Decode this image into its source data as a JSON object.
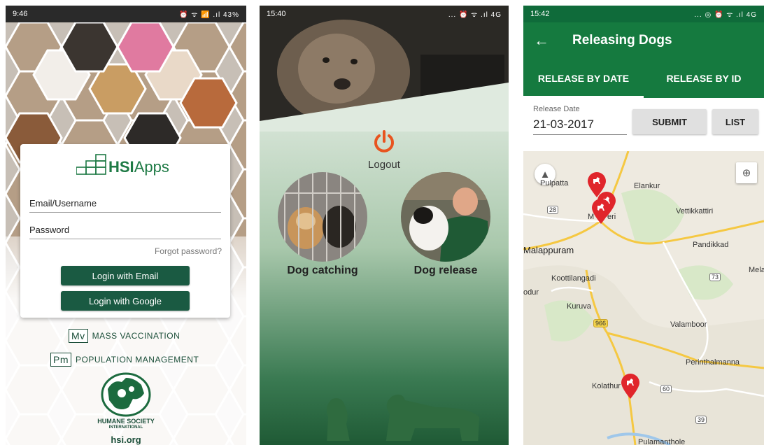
{
  "screen1": {
    "status": {
      "time": "9:46",
      "icons": "⏰ ᯤ 📶 .ıl 43%",
      "battery": "▮"
    },
    "brand": {
      "hsi": "HSI",
      "apps": "Apps"
    },
    "form": {
      "email_label": "Email/Username",
      "password_label": "Password",
      "forgot": "Forgot password?",
      "login_email": "Login with Email",
      "login_google": "Login with Google"
    },
    "programs": [
      {
        "abbr": "Mv",
        "name": "MASS VACCINATION"
      },
      {
        "abbr": "Pm",
        "name": "POPULATION MANAGEMENT"
      }
    ],
    "org": {
      "line1": "HUMANE SOCIETY",
      "line2": "INTERNATIONAL",
      "link": "hsi.org"
    }
  },
  "screen2": {
    "status": {
      "time": "15:40",
      "icons": "... ⏰ ᯤ .ıl 4G"
    },
    "logout": "Logout",
    "menu": [
      {
        "label": "Dog catching"
      },
      {
        "label": "Dog release"
      }
    ]
  },
  "screen3": {
    "status": {
      "time": "15:42",
      "icons": "... ◎ ⏰ ᯤ .ıl 4G"
    },
    "title": "Releasing Dogs",
    "tabs": [
      {
        "label": "RELEASE BY DATE",
        "active": true
      },
      {
        "label": "RELEASE BY ID",
        "active": false
      }
    ],
    "date_label": "Release Date",
    "date_value": "21-03-2017",
    "submit": "SUBMIT",
    "list": "LIST",
    "map": {
      "places": [
        "Pulpatta",
        "Elankur",
        "Vettikkattiri",
        "Malappuram",
        "Pandikkad",
        "Mela",
        "Koottilangadi",
        "odur",
        "Kuruva",
        "Valamboor",
        "Perinthalmanna",
        "Kolathur",
        "Pulamanthole",
        "M",
        "eri"
      ],
      "roads": [
        "28",
        "73",
        "966",
        "60",
        "39"
      ]
    },
    "colors": {
      "primary": "#157a3f",
      "pin": "#e0252b"
    }
  }
}
